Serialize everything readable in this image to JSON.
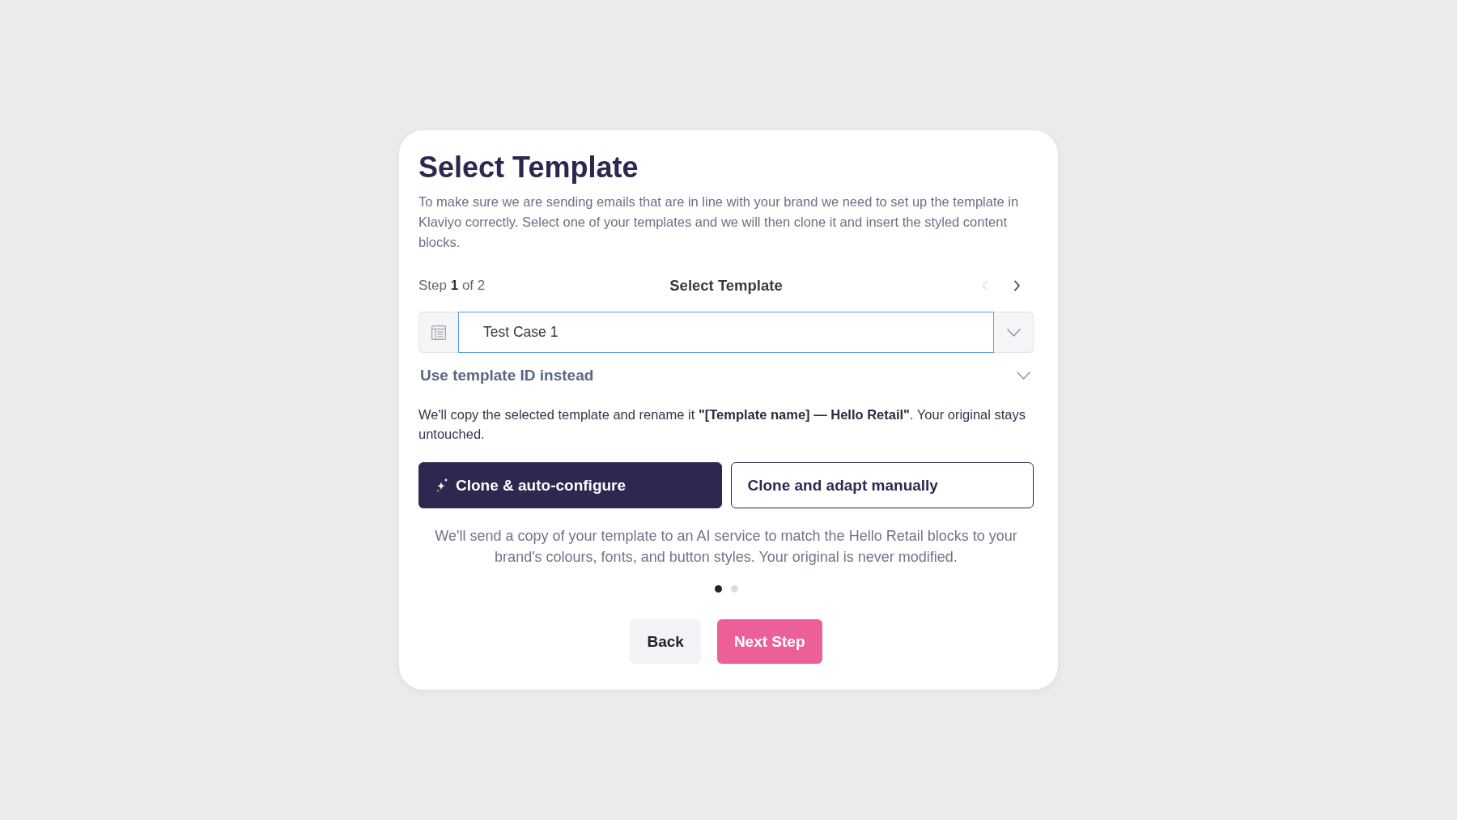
{
  "dialog": {
    "title": "Select Template",
    "description": "To make sure we are sending emails that are in line with your brand we need to set up the template in Klaviyo correctly. Select one of your templates and we will then clone it and insert the styled content blocks."
  },
  "stepper": {
    "step_label": "Step **1** of 2",
    "title": "Select Template",
    "previous_disabled": true,
    "next_disabled": false
  },
  "template_select": {
    "value": "Test Case 1"
  },
  "template_id_toggle": {
    "label": "Use template ID instead",
    "expanded": false
  },
  "rename_note": "We'll copy the selected template and rename it **\"[Template name] — Hello Retail\"**. Your original stays untouched.",
  "mode_options": [
    {
      "kind": "auto",
      "label": "Clone & auto-configure",
      "selected": true
    },
    {
      "kind": "manual",
      "label": "Clone and adapt manually",
      "selected": false
    }
  ],
  "mode_description": "We'll send a copy of your template to an AI service to match the Hello Retail blocks to your brand's colours, fonts, and button styles. Your original is never modified.",
  "pager_dots": [
    {
      "selected": true
    },
    {
      "selected": false
    }
  ],
  "actions": [
    {
      "kind": "secondary",
      "label": "Back"
    },
    {
      "kind": "primary",
      "label": "Next Step"
    }
  ]
}
